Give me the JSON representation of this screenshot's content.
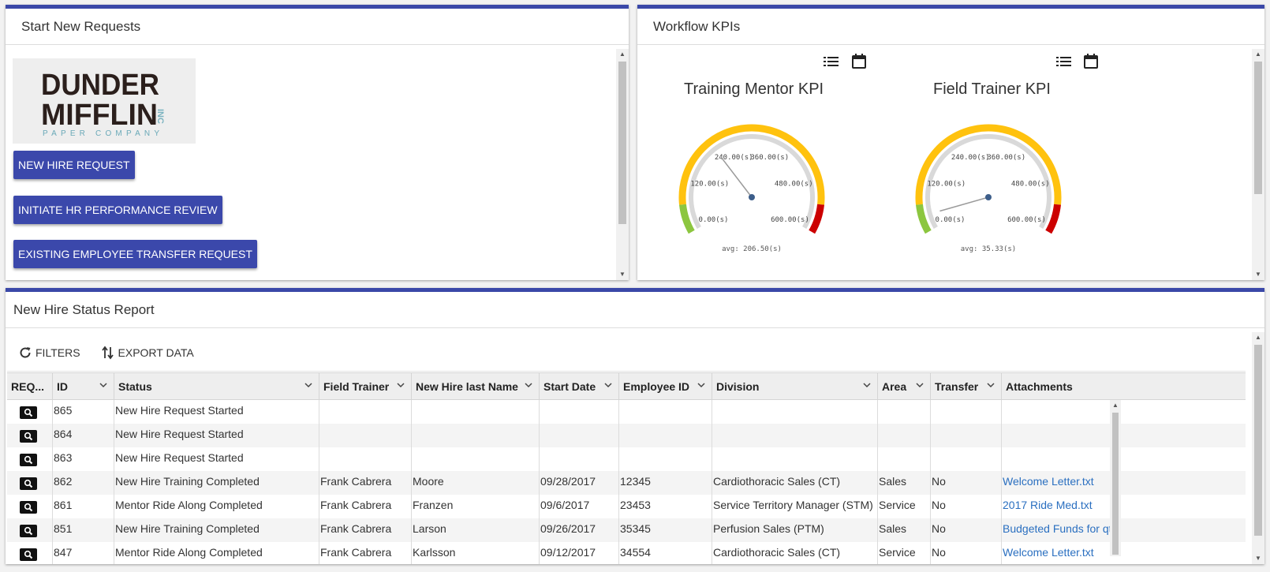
{
  "start_panel": {
    "title": "Start New Requests",
    "logo": {
      "line1": "DUNDER",
      "line2": "MIFFLIN",
      "inc": "INC",
      "tagline": "PAPER COMPANY"
    },
    "buttons": [
      "NEW HIRE REQUEST",
      "INITIATE HR PERFORMANCE REVIEW",
      "EXISTING EMPLOYEE TRANSFER REQUEST"
    ]
  },
  "kpi_panel": {
    "title": "Workflow KPIs",
    "gauges": [
      {
        "title": "Training Mentor KPI",
        "min": 0,
        "max": 600,
        "value": 206.5,
        "ticks": [
          "0.00(s)",
          "120.00(s)",
          "240.00(s)",
          "360.00(s)",
          "480.00(s)",
          "600.00(s)"
        ],
        "avg_label": "avg: 206.50(s)"
      },
      {
        "title": "Field Trainer KPI",
        "min": 0,
        "max": 600,
        "value": 35.33,
        "ticks": [
          "0.00(s)",
          "120.00(s)",
          "240.00(s)",
          "360.00(s)",
          "480.00(s)",
          "600.00(s)"
        ],
        "avg_label": "avg: 35.33(s)"
      }
    ],
    "band_colors": {
      "green": "#8cc63f",
      "yellow": "#ffc20e",
      "red": "#cc0000",
      "track": "#d9d9d9"
    }
  },
  "report_panel": {
    "title": "New Hire Status Report",
    "toolbar": {
      "filters": "FILTERS",
      "export": "EXPORT DATA"
    },
    "columns": [
      "REQ...",
      "ID",
      "Status",
      "Field Trainer",
      "New Hire last Name",
      "Start Date",
      "Employee ID",
      "Division",
      "Area",
      "Transfer",
      "Attachments"
    ],
    "rows": [
      [
        "865",
        "New Hire Request Started",
        "",
        "",
        "",
        "",
        "",
        "",
        "",
        ""
      ],
      [
        "864",
        "New Hire Request Started",
        "",
        "",
        "",
        "",
        "",
        "",
        "",
        ""
      ],
      [
        "863",
        "New Hire Request Started",
        "",
        "",
        "",
        "",
        "",
        "",
        "",
        ""
      ],
      [
        "862",
        "New Hire Training Completed",
        "Frank Cabrera",
        "Moore",
        "09/28/2017",
        "12345",
        "Cardiothoracic Sales (CT)",
        "Sales",
        "No",
        "Welcome Letter.txt"
      ],
      [
        "861",
        "Mentor Ride Along Completed",
        "Frank Cabrera",
        "Franzen",
        "09/6/2017",
        "23453",
        "Service Territory Manager (STM)",
        "Service",
        "No",
        "2017 Ride Med.txt"
      ],
      [
        "851",
        "New Hire Training Completed",
        "Frank Cabrera",
        "Larson",
        "09/26/2017",
        "35345",
        "Perfusion Sales (PTM)",
        "Sales",
        "No",
        "Budgeted Funds for qtr"
      ],
      [
        "847",
        "Mentor Ride Along Completed",
        "Frank Cabrera",
        "Karlsson",
        "09/12/2017",
        "34554",
        "Cardiothoracic Sales (CT)",
        "Service",
        "No",
        "Welcome Letter.txt"
      ]
    ]
  }
}
